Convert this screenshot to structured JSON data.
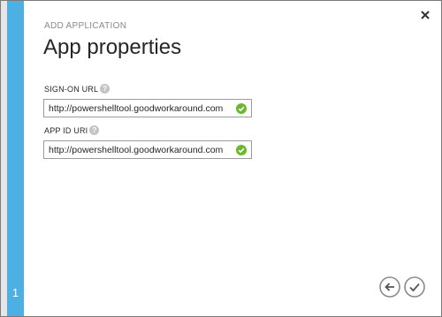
{
  "dialog": {
    "subtitle": "ADD APPLICATION",
    "title": "App properties",
    "step": "1"
  },
  "fields": [
    {
      "label": "SIGN-ON URL",
      "value": "http://powershelltool.goodworkaround.com",
      "help_icon": "question-mark-icon",
      "status_icon": "checkmark-valid-icon"
    },
    {
      "label": "APP ID URI",
      "value": "http://powershelltool.goodworkaround.com",
      "help_icon": "question-mark-icon",
      "status_icon": "checkmark-valid-icon"
    }
  ],
  "icons": {
    "close": "close-icon",
    "back": "back-arrow-icon",
    "complete": "checkmark-icon",
    "help_glyph": "?"
  },
  "colors": {
    "step_rail": "#4cb0e3",
    "valid": "#6bb82f",
    "help": "#c4c4c4",
    "nav_button": "#8a8a8a"
  }
}
